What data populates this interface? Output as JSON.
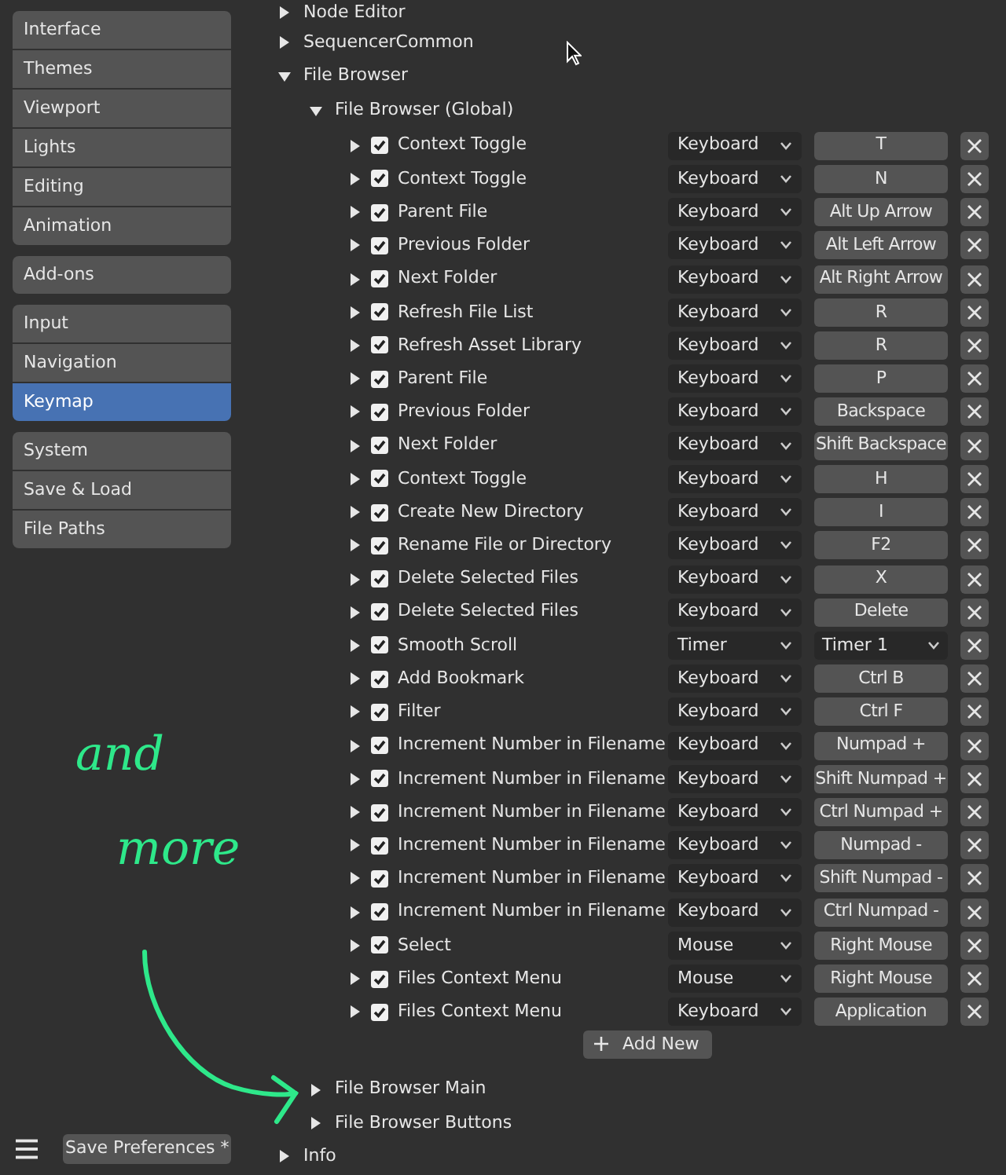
{
  "sidebar": {
    "groups": [
      [
        {
          "label": "Interface",
          "selected": false
        },
        {
          "label": "Themes",
          "selected": false
        },
        {
          "label": "Viewport",
          "selected": false
        },
        {
          "label": "Lights",
          "selected": false
        },
        {
          "label": "Editing",
          "selected": false
        },
        {
          "label": "Animation",
          "selected": false
        }
      ],
      [
        {
          "label": "Add-ons",
          "selected": false
        }
      ],
      [
        {
          "label": "Input",
          "selected": false
        },
        {
          "label": "Navigation",
          "selected": false
        },
        {
          "label": "Keymap",
          "selected": true
        }
      ],
      [
        {
          "label": "System",
          "selected": false
        },
        {
          "label": "Save & Load",
          "selected": false
        },
        {
          "label": "File Paths",
          "selected": false
        }
      ]
    ]
  },
  "footer": {
    "save_button": "Save Preferences *"
  },
  "sections": [
    {
      "label": "Node Editor",
      "expanded": false
    },
    {
      "label": "SequencerCommon",
      "expanded": false
    },
    {
      "label": "File Browser",
      "expanded": true,
      "children": [
        {
          "label": "File Browser (Global)",
          "expanded": true,
          "add_button": "Add New",
          "items": [
            {
              "name": "Context Toggle",
              "enabled": true,
              "expanded": false,
              "type": "Keyboard",
              "key": "T",
              "kind": "button"
            },
            {
              "name": "Context Toggle",
              "enabled": true,
              "expanded": false,
              "type": "Keyboard",
              "key": "N",
              "kind": "button"
            },
            {
              "name": "Parent File",
              "enabled": true,
              "expanded": false,
              "type": "Keyboard",
              "key": "Alt Up Arrow",
              "kind": "button"
            },
            {
              "name": "Previous Folder",
              "enabled": true,
              "expanded": false,
              "type": "Keyboard",
              "key": "Alt Left Arrow",
              "kind": "button"
            },
            {
              "name": "Next Folder",
              "enabled": true,
              "expanded": false,
              "type": "Keyboard",
              "key": "Alt Right Arrow",
              "kind": "button"
            },
            {
              "name": "Refresh File List",
              "enabled": true,
              "expanded": false,
              "type": "Keyboard",
              "key": "R",
              "kind": "button"
            },
            {
              "name": "Refresh Asset Library",
              "enabled": true,
              "expanded": false,
              "type": "Keyboard",
              "key": "R",
              "kind": "button"
            },
            {
              "name": "Parent File",
              "enabled": true,
              "expanded": false,
              "type": "Keyboard",
              "key": "P",
              "kind": "button"
            },
            {
              "name": "Previous Folder",
              "enabled": true,
              "expanded": false,
              "type": "Keyboard",
              "key": "Backspace",
              "kind": "button"
            },
            {
              "name": "Next Folder",
              "enabled": true,
              "expanded": false,
              "type": "Keyboard",
              "key": "Shift Backspace",
              "kind": "button"
            },
            {
              "name": "Context Toggle",
              "enabled": true,
              "expanded": false,
              "type": "Keyboard",
              "key": "H",
              "kind": "button"
            },
            {
              "name": "Create New Directory",
              "enabled": true,
              "expanded": false,
              "type": "Keyboard",
              "key": "I",
              "kind": "button"
            },
            {
              "name": "Rename File or Directory",
              "enabled": true,
              "expanded": false,
              "type": "Keyboard",
              "key": "F2",
              "kind": "button"
            },
            {
              "name": "Delete Selected Files",
              "enabled": true,
              "expanded": false,
              "type": "Keyboard",
              "key": "X",
              "kind": "button"
            },
            {
              "name": "Delete Selected Files",
              "enabled": true,
              "expanded": false,
              "type": "Keyboard",
              "key": "Delete",
              "kind": "button"
            },
            {
              "name": "Smooth Scroll",
              "enabled": true,
              "expanded": false,
              "type": "Timer",
              "key": "Timer 1",
              "kind": "dropdown"
            },
            {
              "name": "Add Bookmark",
              "enabled": true,
              "expanded": false,
              "type": "Keyboard",
              "key": "Ctrl B",
              "kind": "button"
            },
            {
              "name": "Filter",
              "enabled": true,
              "expanded": false,
              "type": "Keyboard",
              "key": "Ctrl F",
              "kind": "button"
            },
            {
              "name": "Increment Number in Filename",
              "enabled": true,
              "expanded": false,
              "type": "Keyboard",
              "key": "Numpad +",
              "kind": "button"
            },
            {
              "name": "Increment Number in Filename",
              "enabled": true,
              "expanded": false,
              "type": "Keyboard",
              "key": "Shift Numpad +",
              "kind": "button"
            },
            {
              "name": "Increment Number in Filename",
              "enabled": true,
              "expanded": false,
              "type": "Keyboard",
              "key": "Ctrl Numpad +",
              "kind": "button"
            },
            {
              "name": "Increment Number in Filename",
              "enabled": true,
              "expanded": false,
              "type": "Keyboard",
              "key": "Numpad -",
              "kind": "button"
            },
            {
              "name": "Increment Number in Filename",
              "enabled": true,
              "expanded": false,
              "type": "Keyboard",
              "key": "Shift Numpad -",
              "kind": "button"
            },
            {
              "name": "Increment Number in Filename",
              "enabled": true,
              "expanded": false,
              "type": "Keyboard",
              "key": "Ctrl Numpad -",
              "kind": "button"
            },
            {
              "name": "Select",
              "enabled": true,
              "expanded": false,
              "type": "Mouse",
              "key": "Right Mouse",
              "kind": "button"
            },
            {
              "name": "Files Context Menu",
              "enabled": true,
              "expanded": false,
              "type": "Mouse",
              "key": "Right Mouse",
              "kind": "button"
            },
            {
              "name": "Files Context Menu",
              "enabled": true,
              "expanded": false,
              "type": "Keyboard",
              "key": "Application",
              "kind": "button"
            }
          ]
        },
        {
          "label": "File Browser Main",
          "expanded": false
        },
        {
          "label": "File Browser Buttons",
          "expanded": false
        }
      ]
    },
    {
      "label": "Info",
      "expanded": false
    }
  ],
  "annotation": {
    "lines": [
      "and",
      "more"
    ]
  }
}
